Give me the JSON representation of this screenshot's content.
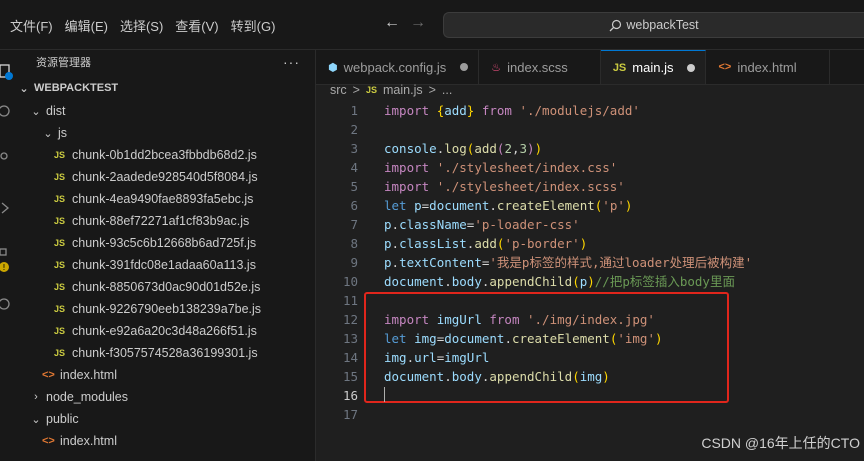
{
  "menu": [
    "文件(F)",
    "编辑(E)",
    "选择(S)",
    "查看(V)",
    "转到(G)"
  ],
  "search": {
    "text": "webpackTest"
  },
  "sidebar": {
    "title": "资源管理器",
    "more": "···",
    "root": "WEBPACKTEST",
    "items": [
      {
        "label": "dist",
        "type": "folder",
        "indent": 1,
        "expanded": true
      },
      {
        "label": "js",
        "type": "folder",
        "indent": 2,
        "expanded": true
      },
      {
        "label": "chunk-0b1dd2bcea3fbbdb68d2.js",
        "type": "js",
        "indent": 3
      },
      {
        "label": "chunk-2aadede928540d5f8084.js",
        "type": "js",
        "indent": 3
      },
      {
        "label": "chunk-4ea9490fae8893fa5ebc.js",
        "type": "js",
        "indent": 3
      },
      {
        "label": "chunk-88ef72271af1cf83b9ac.js",
        "type": "js",
        "indent": 3
      },
      {
        "label": "chunk-93c5c6b12668b6ad725f.js",
        "type": "js",
        "indent": 3
      },
      {
        "label": "chunk-391fdc08e1adaa60a113.js",
        "type": "js",
        "indent": 3
      },
      {
        "label": "chunk-8850673d0ac90d01d52e.js",
        "type": "js",
        "indent": 3
      },
      {
        "label": "chunk-9226790eeb138239a7be.js",
        "type": "js",
        "indent": 3
      },
      {
        "label": "chunk-e92a6a20c3d48a266f51.js",
        "type": "js",
        "indent": 3
      },
      {
        "label": "chunk-f3057574528a36199301.js",
        "type": "js",
        "indent": 3
      },
      {
        "label": "index.html",
        "type": "html",
        "indent": 2
      },
      {
        "label": "node_modules",
        "type": "folder",
        "indent": 1,
        "expanded": false
      },
      {
        "label": "public",
        "type": "folder",
        "indent": 1,
        "expanded": true
      },
      {
        "label": "index.html",
        "type": "html",
        "indent": 2
      }
    ]
  },
  "tabs": [
    {
      "label": "webpack.config.js",
      "icon": "webpack-icon",
      "dirty": true,
      "active": false
    },
    {
      "label": "index.scss",
      "icon": "sass-icon",
      "dirty": false,
      "active": false
    },
    {
      "label": "main.js",
      "icon": "js-icon",
      "dirty": true,
      "active": true
    },
    {
      "label": "index.html",
      "icon": "html-icon",
      "dirty": false,
      "active": false
    }
  ],
  "breadcrumb": [
    "src",
    ">",
    "main.js",
    ">",
    "..."
  ],
  "editor": {
    "current_line": 16,
    "lines": [
      [
        [
          "kw",
          "import "
        ],
        [
          "br",
          "{"
        ],
        [
          "v",
          "add"
        ],
        [
          "br",
          "}"
        ],
        [
          "kw",
          " from "
        ],
        [
          "s",
          "'./modulejs/add'"
        ]
      ],
      [],
      [
        [
          "v",
          "console"
        ],
        [
          "p",
          "."
        ],
        [
          "f",
          "log"
        ],
        [
          "br",
          "("
        ],
        [
          "f",
          "add"
        ],
        [
          "kw",
          "("
        ],
        [
          "n",
          "2"
        ],
        [
          "p",
          ","
        ],
        [
          "n",
          "3"
        ],
        [
          "kw",
          ")"
        ],
        [
          "br",
          ")"
        ]
      ],
      [
        [
          "kw",
          "import "
        ],
        [
          "s",
          "'./stylesheet/index.css'"
        ]
      ],
      [
        [
          "kw",
          "import "
        ],
        [
          "s",
          "'./stylesheet/index.scss'"
        ]
      ],
      [
        [
          "k",
          "let "
        ],
        [
          "v",
          "p"
        ],
        [
          "p",
          "="
        ],
        [
          "v",
          "document"
        ],
        [
          "p",
          "."
        ],
        [
          "f",
          "createElement"
        ],
        [
          "br",
          "("
        ],
        [
          "s",
          "'p'"
        ],
        [
          "br",
          ")"
        ]
      ],
      [
        [
          "v",
          "p"
        ],
        [
          "p",
          "."
        ],
        [
          "v",
          "className"
        ],
        [
          "p",
          "="
        ],
        [
          "s",
          "'p-loader-css'"
        ]
      ],
      [
        [
          "v",
          "p"
        ],
        [
          "p",
          "."
        ],
        [
          "v",
          "classList"
        ],
        [
          "p",
          "."
        ],
        [
          "f",
          "add"
        ],
        [
          "br",
          "("
        ],
        [
          "s",
          "'p-border'"
        ],
        [
          "br",
          ")"
        ]
      ],
      [
        [
          "v",
          "p"
        ],
        [
          "p",
          "."
        ],
        [
          "v",
          "textContent"
        ],
        [
          "p",
          "="
        ],
        [
          "s",
          "'我是p标签的样式,通过loader处理后被构建'"
        ]
      ],
      [
        [
          "v",
          "document"
        ],
        [
          "p",
          "."
        ],
        [
          "v",
          "body"
        ],
        [
          "p",
          "."
        ],
        [
          "f",
          "appendChild"
        ],
        [
          "br",
          "("
        ],
        [
          "v",
          "p"
        ],
        [
          "br",
          ")"
        ],
        [
          "c",
          "//把p标签插入body里面"
        ]
      ],
      [],
      [
        [
          "kw",
          "import "
        ],
        [
          "v",
          "imgUrl"
        ],
        [
          "kw",
          " from "
        ],
        [
          "s",
          "'./img/index.jpg'"
        ]
      ],
      [
        [
          "k",
          "let "
        ],
        [
          "v",
          "img"
        ],
        [
          "p",
          "="
        ],
        [
          "v",
          "document"
        ],
        [
          "p",
          "."
        ],
        [
          "f",
          "createElement"
        ],
        [
          "br",
          "("
        ],
        [
          "s",
          "'img'"
        ],
        [
          "br",
          ")"
        ]
      ],
      [
        [
          "v",
          "img"
        ],
        [
          "p",
          "."
        ],
        [
          "v",
          "url"
        ],
        [
          "p",
          "="
        ],
        [
          "v",
          "imgUrl"
        ]
      ],
      [
        [
          "v",
          "document"
        ],
        [
          "p",
          "."
        ],
        [
          "v",
          "body"
        ],
        [
          "p",
          "."
        ],
        [
          "f",
          "appendChild"
        ],
        [
          "br",
          "("
        ],
        [
          "v",
          "img"
        ],
        [
          "br",
          ")"
        ]
      ],
      [],
      []
    ]
  },
  "watermark": "CSDN @16年上任的CTO",
  "colors": {
    "highlight_box": "#e0261c",
    "accent": "#0078d4",
    "background": "#1f1f1f"
  }
}
